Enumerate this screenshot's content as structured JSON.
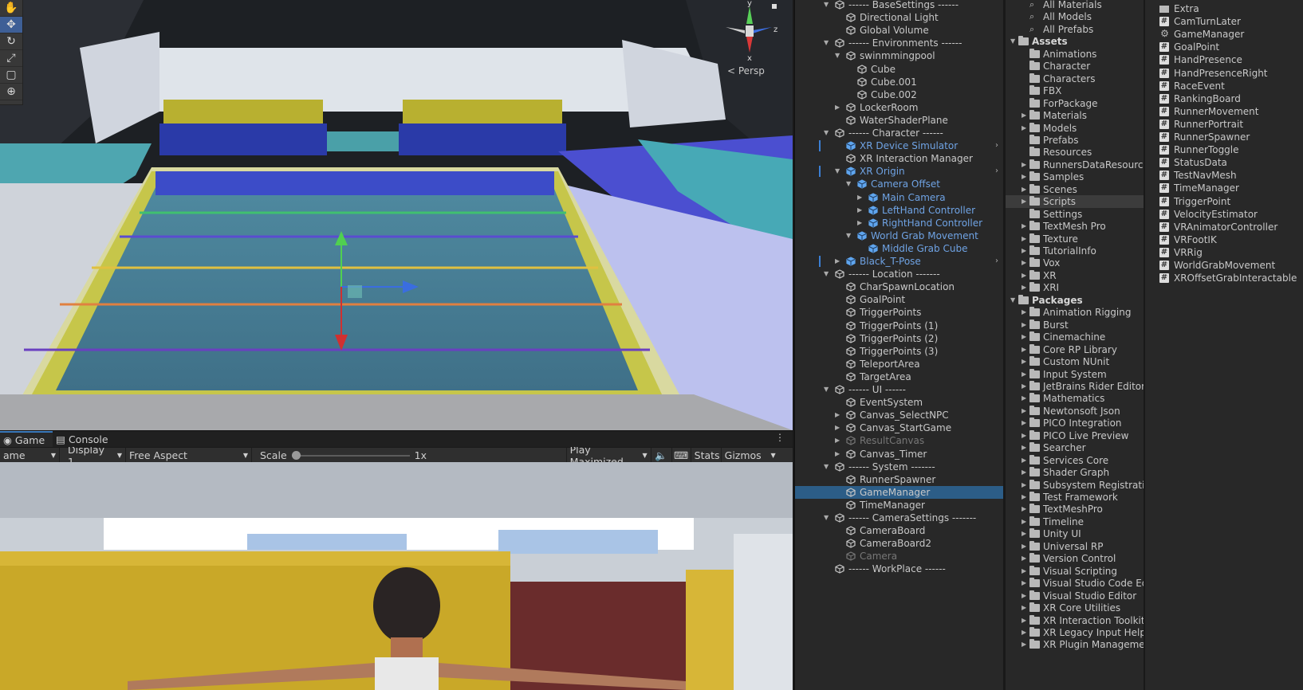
{
  "scene_view": {
    "tools": [
      "hand-tool",
      "move-tool",
      "rotate-tool",
      "scale-tool",
      "rect-tool",
      "transform-tool"
    ],
    "active_tool": 1,
    "gizmo_axes": {
      "y": "y",
      "z": "z",
      "x": "x"
    },
    "projection_label": "< Persp"
  },
  "game_panel": {
    "tabs": [
      {
        "label": "Game",
        "icon": "gamepad-icon"
      },
      {
        "label": "Console",
        "icon": "console-icon"
      }
    ],
    "toolbar": {
      "mode": "ame",
      "display": "Display 1",
      "aspect": "Free Aspect",
      "scale_label": "Scale",
      "scale_value": "1x",
      "play_mode": "Play Maximized",
      "stats": "Stats",
      "gizmos": "Gizmos"
    }
  },
  "hierarchy": {
    "items": [
      {
        "label": "------ BaseSettings ------",
        "depth": 0,
        "expand": "open"
      },
      {
        "label": "Directional Light",
        "depth": 1
      },
      {
        "label": "Global Volume",
        "depth": 1
      },
      {
        "label": "------ Environments ------",
        "depth": 0,
        "expand": "open"
      },
      {
        "label": "swinmmingpool",
        "depth": 1,
        "expand": "open"
      },
      {
        "label": "Cube",
        "depth": 2
      },
      {
        "label": "Cube.001",
        "depth": 2
      },
      {
        "label": "Cube.002",
        "depth": 2
      },
      {
        "label": "LockerRoom",
        "depth": 1,
        "expand": "closed"
      },
      {
        "label": "WaterShaderPlane",
        "depth": 1
      },
      {
        "label": "------ Character ------",
        "depth": 0,
        "expand": "open"
      },
      {
        "label": "XR Device Simulator",
        "depth": 1,
        "prefab": true,
        "bar": true,
        "arrow": true
      },
      {
        "label": "XR Interaction Manager",
        "depth": 1
      },
      {
        "label": "XR Origin",
        "depth": 1,
        "prefab": true,
        "expand": "open",
        "bar": true,
        "arrow": true
      },
      {
        "label": "Camera Offset",
        "depth": 2,
        "prefab": true,
        "expand": "open"
      },
      {
        "label": "Main Camera",
        "depth": 3,
        "prefab": true,
        "expand": "closed"
      },
      {
        "label": "LeftHand Controller",
        "depth": 3,
        "prefab": true,
        "expand": "closed"
      },
      {
        "label": "RightHand Controller",
        "depth": 3,
        "prefab": true,
        "expand": "closed"
      },
      {
        "label": "World Grab Movement",
        "depth": 2,
        "prefab": true,
        "expand": "open"
      },
      {
        "label": "Middle Grab Cube",
        "depth": 3,
        "prefab": true
      },
      {
        "label": "Black_T-Pose",
        "depth": 1,
        "prefab": true,
        "expand": "closed",
        "bar": true,
        "arrow": true
      },
      {
        "label": "------ Location -------",
        "depth": 0,
        "expand": "open"
      },
      {
        "label": "CharSpawnLocation",
        "depth": 1
      },
      {
        "label": "GoalPoint",
        "depth": 1
      },
      {
        "label": "TriggerPoints",
        "depth": 1
      },
      {
        "label": "TriggerPoints (1)",
        "depth": 1
      },
      {
        "label": "TriggerPoints (2)",
        "depth": 1
      },
      {
        "label": "TriggerPoints (3)",
        "depth": 1
      },
      {
        "label": "TeleportArea",
        "depth": 1
      },
      {
        "label": "TargetArea",
        "depth": 1
      },
      {
        "label": "------ UI ------",
        "depth": 0,
        "expand": "open"
      },
      {
        "label": "EventSystem",
        "depth": 1
      },
      {
        "label": "Canvas_SelectNPC",
        "depth": 1,
        "expand": "closed"
      },
      {
        "label": "Canvas_StartGame",
        "depth": 1,
        "expand": "closed"
      },
      {
        "label": "ResultCanvas",
        "depth": 1,
        "expand": "closed",
        "dim": true
      },
      {
        "label": "Canvas_Timer",
        "depth": 1,
        "expand": "closed"
      },
      {
        "label": "------ System -------",
        "depth": 0,
        "expand": "open"
      },
      {
        "label": "RunnerSpawner",
        "depth": 1
      },
      {
        "label": "GameManager",
        "depth": 1,
        "selected": true
      },
      {
        "label": "TimeManager",
        "depth": 1
      },
      {
        "label": "------ CameraSettings -------",
        "depth": 0,
        "expand": "open"
      },
      {
        "label": "CameraBoard",
        "depth": 1
      },
      {
        "label": "CameraBoard2",
        "depth": 1
      },
      {
        "label": "Camera",
        "depth": 1,
        "dim": true
      },
      {
        "label": "------ WorkPlace ------",
        "depth": 0
      }
    ]
  },
  "project": {
    "items": [
      {
        "label": "All Materials",
        "kind": "search"
      },
      {
        "label": "All Models",
        "kind": "search"
      },
      {
        "label": "All Prefabs",
        "kind": "search"
      },
      {
        "label": "Assets",
        "kind": "root"
      },
      {
        "label": "Animations",
        "kind": "folder"
      },
      {
        "label": "Character",
        "kind": "folder"
      },
      {
        "label": "Characters",
        "kind": "folder"
      },
      {
        "label": "FBX",
        "kind": "folder"
      },
      {
        "label": "ForPackage",
        "kind": "folder"
      },
      {
        "label": "Materials",
        "kind": "folder",
        "expand": true
      },
      {
        "label": "Models",
        "kind": "folder",
        "expand": true
      },
      {
        "label": "Prefabs",
        "kind": "folder"
      },
      {
        "label": "Resources",
        "kind": "folder"
      },
      {
        "label": "RunnersDataResources",
        "kind": "folder",
        "expand": true
      },
      {
        "label": "Samples",
        "kind": "folder",
        "expand": true
      },
      {
        "label": "Scenes",
        "kind": "folder",
        "expand": true
      },
      {
        "label": "Scripts",
        "kind": "folder",
        "expand": true,
        "selected": true
      },
      {
        "label": "Settings",
        "kind": "folder"
      },
      {
        "label": "TextMesh Pro",
        "kind": "folder",
        "expand": true
      },
      {
        "label": "Texture",
        "kind": "folder",
        "expand": true
      },
      {
        "label": "TutorialInfo",
        "kind": "folder",
        "expand": true
      },
      {
        "label": "Vox",
        "kind": "folder",
        "expand": true
      },
      {
        "label": "XR",
        "kind": "folder",
        "expand": true
      },
      {
        "label": "XRI",
        "kind": "folder",
        "expand": true
      },
      {
        "label": "Packages",
        "kind": "root"
      },
      {
        "label": "Animation Rigging",
        "kind": "folder",
        "expand": true
      },
      {
        "label": "Burst",
        "kind": "folder",
        "expand": true
      },
      {
        "label": "Cinemachine",
        "kind": "folder",
        "expand": true
      },
      {
        "label": "Core RP Library",
        "kind": "folder",
        "expand": true
      },
      {
        "label": "Custom NUnit",
        "kind": "folder",
        "expand": true
      },
      {
        "label": "Input System",
        "kind": "folder",
        "expand": true
      },
      {
        "label": "JetBrains Rider Editor",
        "kind": "folder",
        "expand": true
      },
      {
        "label": "Mathematics",
        "kind": "folder",
        "expand": true
      },
      {
        "label": "Newtonsoft Json",
        "kind": "folder",
        "expand": true
      },
      {
        "label": "PICO Integration",
        "kind": "folder",
        "expand": true
      },
      {
        "label": "PICO Live Preview",
        "kind": "folder",
        "expand": true
      },
      {
        "label": "Searcher",
        "kind": "folder",
        "expand": true
      },
      {
        "label": "Services Core",
        "kind": "folder",
        "expand": true
      },
      {
        "label": "Shader Graph",
        "kind": "folder",
        "expand": true
      },
      {
        "label": "Subsystem Registration",
        "kind": "folder",
        "expand": true
      },
      {
        "label": "Test Framework",
        "kind": "folder",
        "expand": true
      },
      {
        "label": "TextMeshPro",
        "kind": "folder",
        "expand": true
      },
      {
        "label": "Timeline",
        "kind": "folder",
        "expand": true
      },
      {
        "label": "Unity UI",
        "kind": "folder",
        "expand": true
      },
      {
        "label": "Universal RP",
        "kind": "folder",
        "expand": true
      },
      {
        "label": "Version Control",
        "kind": "folder",
        "expand": true
      },
      {
        "label": "Visual Scripting",
        "kind": "folder",
        "expand": true
      },
      {
        "label": "Visual Studio Code Editor",
        "kind": "folder",
        "expand": true
      },
      {
        "label": "Visual Studio Editor",
        "kind": "folder",
        "expand": true
      },
      {
        "label": "XR Core Utilities",
        "kind": "folder",
        "expand": true
      },
      {
        "label": "XR Interaction Toolkit",
        "kind": "folder",
        "expand": true
      },
      {
        "label": "XR Legacy Input Helpers",
        "kind": "folder",
        "expand": true
      },
      {
        "label": "XR Plugin Management",
        "kind": "folder",
        "expand": true
      }
    ]
  },
  "files": {
    "items": [
      {
        "label": "Extra",
        "kind": "folder"
      },
      {
        "label": "CamTurnLater",
        "kind": "script"
      },
      {
        "label": "GameManager",
        "kind": "gear"
      },
      {
        "label": "GoalPoint",
        "kind": "script"
      },
      {
        "label": "HandPresence",
        "kind": "script"
      },
      {
        "label": "HandPresenceRight",
        "kind": "script"
      },
      {
        "label": "RaceEvent",
        "kind": "script"
      },
      {
        "label": "RankingBoard",
        "kind": "script"
      },
      {
        "label": "RunnerMovement",
        "kind": "script"
      },
      {
        "label": "RunnerPortrait",
        "kind": "script"
      },
      {
        "label": "RunnerSpawner",
        "kind": "script"
      },
      {
        "label": "RunnerToggle",
        "kind": "script"
      },
      {
        "label": "StatusData",
        "kind": "script"
      },
      {
        "label": "TestNavMesh",
        "kind": "script"
      },
      {
        "label": "TimeManager",
        "kind": "script"
      },
      {
        "label": "TriggerPoint",
        "kind": "script"
      },
      {
        "label": "VelocityEstimator",
        "kind": "script"
      },
      {
        "label": "VRAnimatorController",
        "kind": "script"
      },
      {
        "label": "VRFootIK",
        "kind": "script"
      },
      {
        "label": "VRRig",
        "kind": "script"
      },
      {
        "label": "WorldGrabMovement",
        "kind": "script"
      },
      {
        "label": "XROffsetGrabInteractable",
        "kind": "script"
      }
    ]
  }
}
